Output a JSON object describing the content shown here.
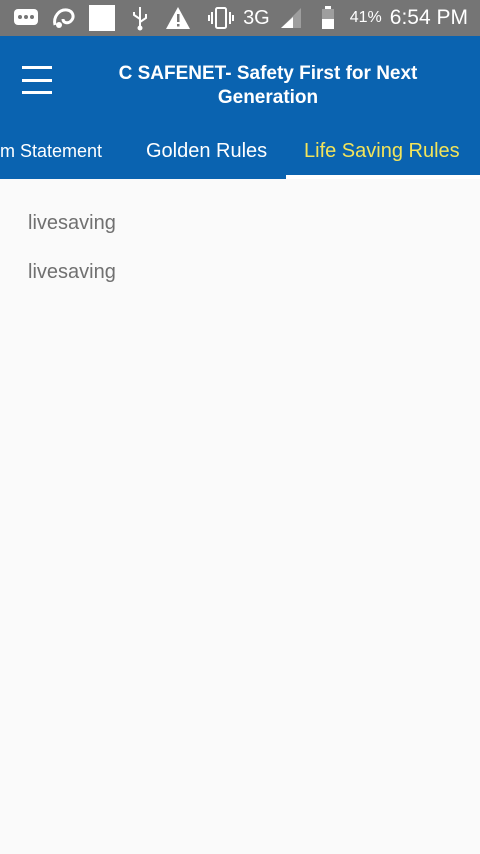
{
  "status_bar": {
    "network": "3G",
    "battery_percent": "41%",
    "time": "6:54 PM",
    "icons": [
      "message-icon",
      "uc-browser-icon",
      "white-square-icon",
      "usb-icon",
      "warning-icon",
      "vibrate-icon",
      "signal-icon",
      "battery-icon"
    ]
  },
  "app_bar": {
    "title": "C SAFENET- Safety First for Next Generation"
  },
  "tabs": [
    {
      "label": "em Statement",
      "selected": false
    },
    {
      "label": "Golden Rules",
      "selected": false
    },
    {
      "label": "Life Saving Rules",
      "selected": true
    }
  ],
  "list": {
    "items": [
      "livesaving",
      "livesaving"
    ]
  },
  "colors": {
    "primary": "#0a63b0",
    "status_bar": "#757575",
    "selected_tab": "#f3e45a",
    "background": "#fafafa"
  }
}
